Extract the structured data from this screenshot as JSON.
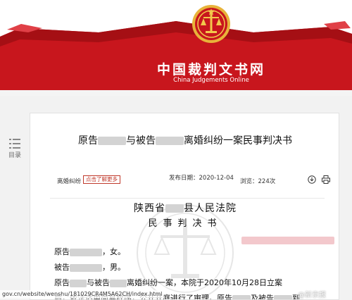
{
  "banner": {
    "title_cn": "中国裁判文书网",
    "title_en": "China Judgements Online"
  },
  "sidebar": {
    "toc_label": "目录"
  },
  "document": {
    "title_prefix": "原告",
    "title_mid": "与被告",
    "title_suffix": "离婚纠纷一案民事判决书",
    "cause_label": "离婚纠纷",
    "tag_button": "点击了解更多",
    "publish_date_label": "发布日期：",
    "publish_date_value": "2020-12-04",
    "views": "浏览：224次",
    "court_prefix": "陕西省",
    "court_suffix": "县人民法院",
    "doc_kind": "民事判决书",
    "paragraphs": {
      "p1_prefix": "原告",
      "p1_suffix": "，女。",
      "p2_prefix": "被告",
      "p2_suffix": "，男。",
      "p3_prefix": "原告",
      "p3_mid": "与被告",
      "p3_suffix": "离婚纠纷一案，本院于2020年10月28日立案",
      "p4_text": "后，依法适用简易程序，公开开庭进行了审理。原告",
      "p4_mid": "及被告",
      "p4_suffix": "到"
    }
  },
  "url_bar": "gov.cn/website/wenshu/181029CR4M5A62CH/index.html",
  "weibo_mark": "@新京报",
  "icons": [
    "emblem-icon",
    "toc-icon",
    "download-icon",
    "print-icon",
    "court-watermark-icon"
  ],
  "colors": {
    "banner_red": "#c8161d",
    "banner_dark_red": "#a50f14",
    "tag_red": "#c0392b"
  }
}
